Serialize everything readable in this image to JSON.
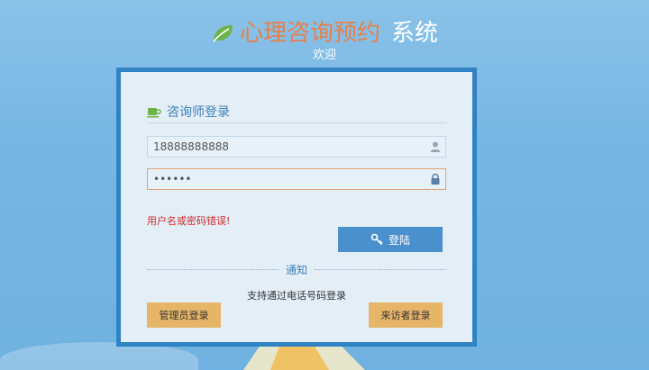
{
  "header": {
    "title_main": "心理咨询预约",
    "title_sub": "系统",
    "welcome": "欢迎"
  },
  "login": {
    "heading": "咨询师登录",
    "username_value": "18888888888",
    "password_value": "••••••",
    "error_text": "用户名或密码错误!",
    "login_button": "登陆"
  },
  "notice": {
    "divider_label": "通知",
    "text": "支持通过电话号码登录"
  },
  "alt_login": {
    "admin_button": "管理员登录",
    "visitor_button": "来访者登录"
  },
  "icons": {
    "brand": "leaf-icon",
    "heading": "coffee-cup-icon",
    "username": "user-icon",
    "password": "lock-icon",
    "login": "key-icon"
  },
  "colors": {
    "accent_orange": "#e8804a",
    "panel_border": "#2f82c4",
    "login_button": "#4a90cc",
    "secondary_button": "#e6b568",
    "error": "#d32b2b",
    "leaf_green": "#6db347"
  }
}
